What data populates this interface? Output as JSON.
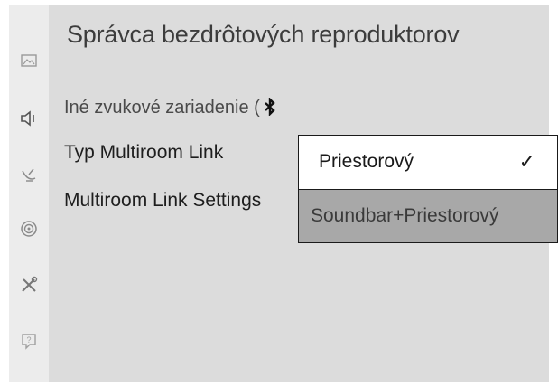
{
  "page": {
    "title": "Správca bezdrôtových reproduktorov"
  },
  "sidebar": {
    "icons": [
      "picture-icon",
      "speaker-icon",
      "satellite-icon",
      "network-icon",
      "tools-icon",
      "support-icon"
    ]
  },
  "menu": {
    "other_device": "Iné zvukové zariadenie (",
    "link_type": "Typ Multiroom Link",
    "link_settings": "Multiroom Link Settings"
  },
  "dropdown": {
    "options": [
      {
        "label": "Priestorový",
        "selected": true
      },
      {
        "label": "Soundbar+Priestorový",
        "selected": false
      }
    ],
    "check_mark": "✓"
  }
}
